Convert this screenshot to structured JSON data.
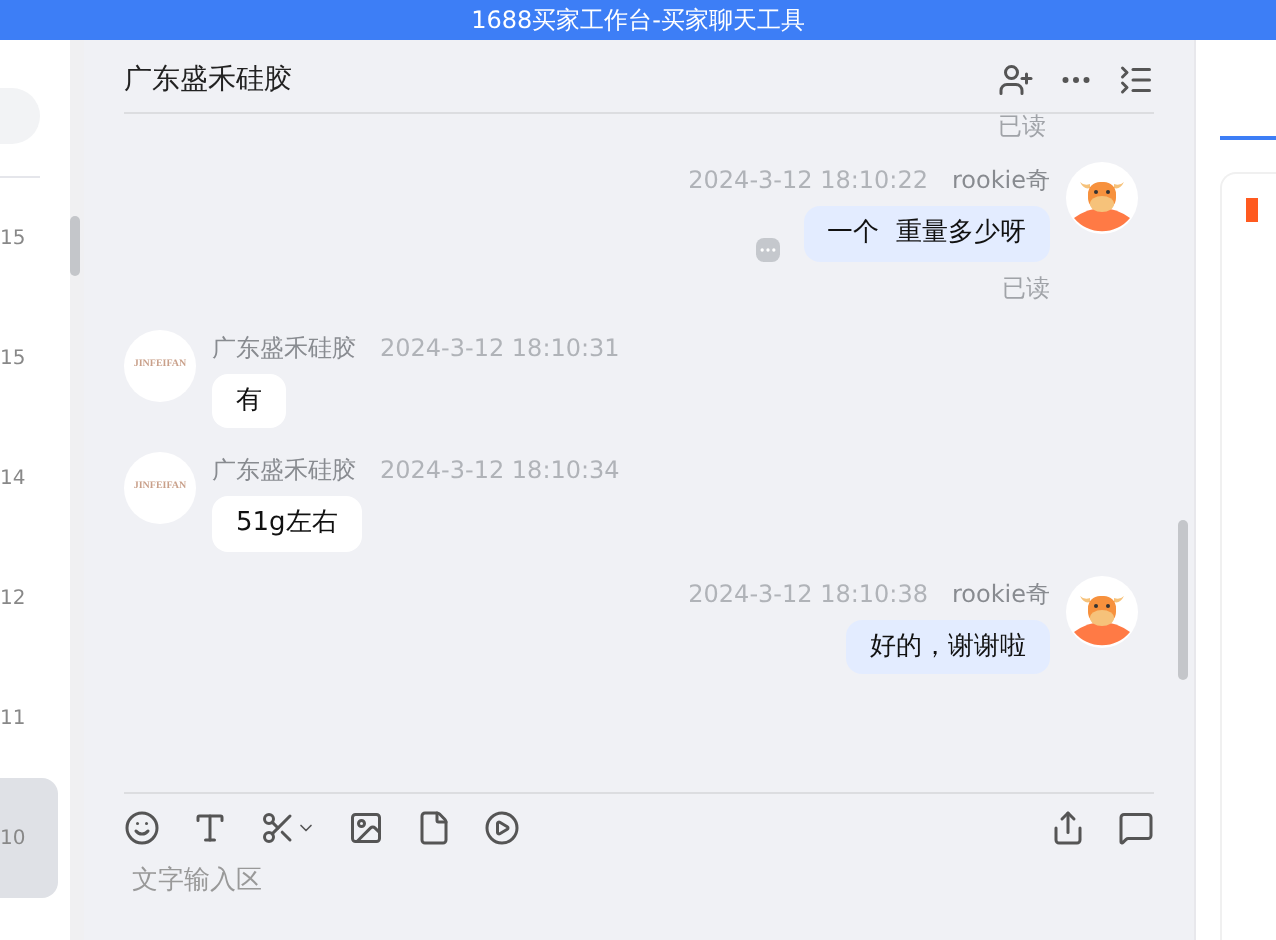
{
  "window": {
    "title": "1688买家工作台-买家聊天工具"
  },
  "sidebar": {
    "items": [
      {
        "time": "15",
        "selected": false
      },
      {
        "time": "15",
        "selected": false
      },
      {
        "time": "14",
        "selected": false
      },
      {
        "time": "12",
        "selected": false
      },
      {
        "time": "11",
        "selected": false
      },
      {
        "time": "10",
        "selected": true
      }
    ]
  },
  "chat": {
    "title": "广东盛禾硅胶",
    "top_read": "已读",
    "messages": [
      {
        "kind": "mine",
        "sender": "rookie奇",
        "time": "2024-3-12 18:10:22",
        "text": "一个  重量多少呀",
        "read": "已读"
      },
      {
        "kind": "theirs",
        "sender": "广东盛禾硅胶",
        "time": "2024-3-12 18:10:31",
        "text": "有",
        "logo": "JINFEIFAN"
      },
      {
        "kind": "theirs",
        "sender": "广东盛禾硅胶",
        "time": "2024-3-12 18:10:34",
        "text": "51g左右",
        "logo": "JINFEIFAN"
      },
      {
        "kind": "mine",
        "sender": "rookie奇",
        "time": "2024-3-12 18:10:38",
        "text": "好的，谢谢啦"
      }
    ],
    "input": {
      "placeholder": "文字输入区"
    }
  }
}
